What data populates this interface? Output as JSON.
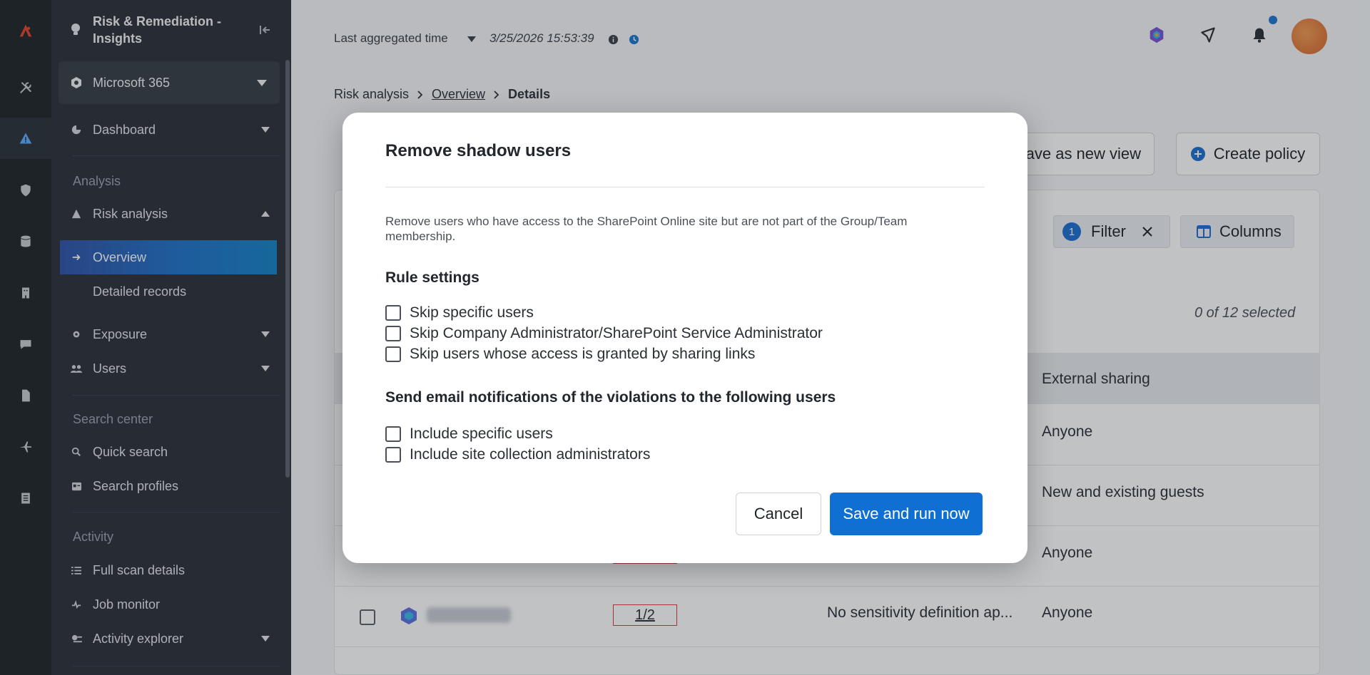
{
  "sidebar": {
    "product_title": "Risk & Remediation - Insights",
    "tenant": "Microsoft 365",
    "dashboard": "Dashboard",
    "analysis_section": "Analysis",
    "risk_analysis": "Risk analysis",
    "overview": "Overview",
    "detailed_records": "Detailed records",
    "exposure": "Exposure",
    "users": "Users",
    "search_section": "Search center",
    "quick_search": "Quick search",
    "search_profiles": "Search profiles",
    "activity_section": "Activity",
    "full_scan": "Full scan details",
    "job_monitor": "Job monitor",
    "activity_explorer": "Activity explorer"
  },
  "topbar": {
    "agg_label": "Last aggregated time",
    "agg_time": "3/25/2026 15:53:39"
  },
  "breadcrumb": {
    "root": "Risk analysis",
    "overview": "Overview",
    "current": "Details"
  },
  "page": {
    "save_view": "Save as new view",
    "create_policy": "Create policy",
    "filter_count": "1",
    "filter_label": "Filter",
    "columns_label": "Columns",
    "selected": "0 of 12 selected",
    "col_external": "External sharing",
    "rows": [
      {
        "external": "Anyone"
      },
      {
        "external": "New and existing guests"
      },
      {
        "external": "Anyone"
      },
      {
        "ratio": "1/2",
        "sensitivity": "No sensitivity definition ap...",
        "external": "Anyone"
      }
    ]
  },
  "dialog": {
    "title": "Remove shadow users",
    "description": "Remove users who have access to the SharePoint Online site but are not part of the Group/Team membership.",
    "rule_settings": "Rule settings",
    "rule_options": [
      "Skip specific users",
      "Skip Company Administrator/SharePoint Service Administrator",
      "Skip users whose access is granted by sharing links"
    ],
    "notify_heading": "Send email notifications of the violations to the following users",
    "notify_options": [
      "Include specific users",
      "Include site collection administrators"
    ],
    "cancel": "Cancel",
    "confirm": "Save and run now"
  },
  "colors": {
    "accent": "#0f6fd3",
    "sidebar_bg": "#2b3038",
    "rail_bg": "#1f2328",
    "active_nav": "#1f72c9"
  }
}
